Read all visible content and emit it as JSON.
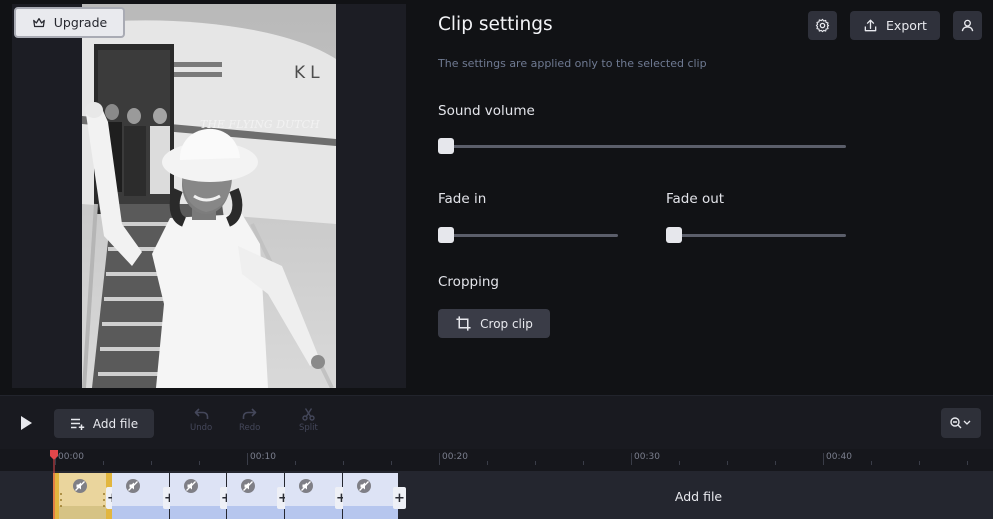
{
  "preview": {
    "upgrade_label": "Upgrade",
    "image_text": {
      "logo": "KL",
      "fuselage": "THE FLYING DUTCH"
    }
  },
  "header": {
    "title": "Clip settings",
    "subtitle": "The settings are applied only to the selected clip",
    "export_label": "Export"
  },
  "settings": {
    "sound_volume": {
      "label": "Sound volume",
      "value": 0
    },
    "fade_in": {
      "label": "Fade in",
      "value": 0
    },
    "fade_out": {
      "label": "Fade out",
      "value": 0
    },
    "cropping": {
      "label": "Cropping",
      "button_label": "Crop clip"
    }
  },
  "toolbar": {
    "add_file_label": "Add file",
    "undo_label": "Undo",
    "redo_label": "Redo",
    "split_label": "Split"
  },
  "ruler": {
    "labels": [
      "00:00",
      "00:10",
      "00:20",
      "00:30",
      "00:40"
    ]
  },
  "timeline": {
    "add_file_label": "Add file",
    "clip_count": 6,
    "selected_clip": 1
  },
  "colors": {
    "background": "#111215",
    "panel": "#191a20",
    "selected_clip_border": "#e2b63f",
    "clip_fill": "#dde3f5",
    "playhead": "#e2474b"
  }
}
